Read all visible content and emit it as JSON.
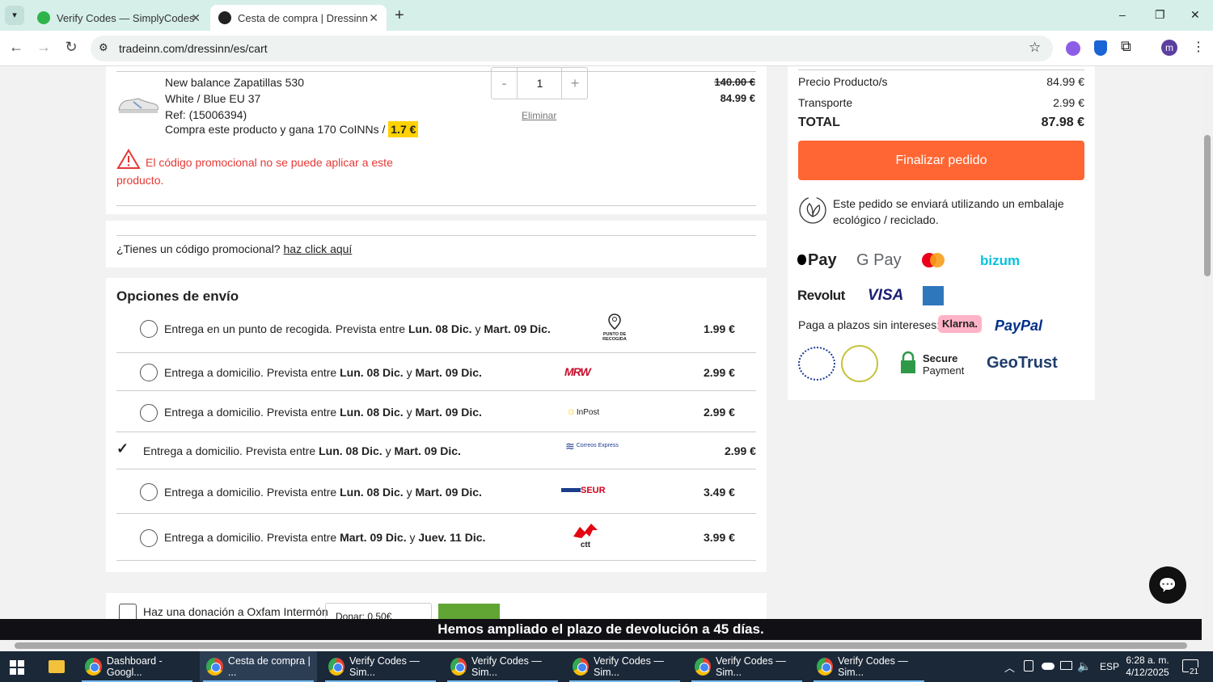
{
  "browser": {
    "tabs": [
      {
        "title": "Verify Codes — SimplyCodes",
        "active": false
      },
      {
        "title": "Cesta de compra | Dressinn",
        "active": true
      }
    ],
    "new_tab": "+",
    "url": "tradeinn.com/dressinn/es/cart",
    "window_controls": {
      "minimize": "–",
      "maximize": "❐",
      "close": "✕"
    },
    "profile_initial": "m"
  },
  "product": {
    "name": "New balance Zapatillas 530",
    "variant": "White / Blue EU 37",
    "ref": "Ref: (15006394)",
    "coins_text": "Compra este producto y gana 170 CoINNs / ",
    "coins_value": "1.7 €",
    "quantity": "1",
    "minus": "-",
    "plus": "+",
    "remove": "Eliminar",
    "old_price": "140.00 €",
    "price": "84.99 €",
    "promo_error": "El código promocional no se puede aplicar a este producto."
  },
  "promo": {
    "question": "¿Tienes un código promocional? ",
    "link": "haz click aquí"
  },
  "shipping": {
    "title": "Opciones de envío",
    "options": [
      {
        "pre": "Entrega en un punto de recogida. Prevista entre ",
        "d1": "Lun. 08 Dic.",
        "mid": " y ",
        "d2": "Mart. 09 Dic.",
        "carrier": "PUNTO DE RECOGIDA",
        "price": "1.99 €",
        "selected": false
      },
      {
        "pre": "Entrega a domicilio. Prevista entre ",
        "d1": "Lun. 08 Dic.",
        "mid": " y ",
        "d2": "Mart. 09 Dic.",
        "carrier": "MRW",
        "price": "2.99 €",
        "selected": false
      },
      {
        "pre": "Entrega a domicilio. Prevista entre ",
        "d1": "Lun. 08 Dic.",
        "mid": " y ",
        "d2": "Mart. 09 Dic.",
        "carrier": "InPost",
        "price": "2.99 €",
        "selected": false
      },
      {
        "pre": "Entrega a domicilio. Prevista entre ",
        "d1": "Lun. 08 Dic.",
        "mid": " y ",
        "d2": "Mart. 09 Dic.",
        "carrier": "Correos Express",
        "price": "2.99 €",
        "selected": true
      },
      {
        "pre": "Entrega a domicilio. Prevista entre ",
        "d1": "Lun. 08 Dic.",
        "mid": " y ",
        "d2": "Mart. 09 Dic.",
        "carrier": "SEUR",
        "price": "3.49 €",
        "selected": false
      },
      {
        "pre": "Entrega a domicilio. Prevista entre ",
        "d1": "Mart. 09 Dic.",
        "mid": " y ",
        "d2": "Juev. 11 Dic.",
        "carrier": "ctt",
        "price": "3.99 €",
        "selected": false
      }
    ]
  },
  "donation": {
    "label": "Haz una donación a Oxfam Intermón",
    "select_value": "Donar: 0.50€"
  },
  "summary": {
    "product_label": "Precio Producto/s",
    "product_value": "84.99 €",
    "shipping_label": "Transporte",
    "shipping_value": "2.99 €",
    "total_label": "TOTAL",
    "total_value": "87.98 €",
    "checkout_button": "Finalizar pedido",
    "eco_text": "Este pedido se enviará utilizando un embalaje ecológico / reciclado.",
    "payments": {
      "apple": "Pay",
      "google": "G Pay",
      "bizum": "bizum",
      "revolut": "Revolut",
      "visa": "VISA",
      "klarna_label": "Paga a plazos sin intereses:",
      "klarna": "Klarna.",
      "paypal": "PayPal"
    },
    "trust": {
      "secure_1": "Secure",
      "secure_2": "Payment",
      "geotrust": "GeoTrust"
    }
  },
  "banner": "Hemos ampliado el plazo de devolución a 45 días.",
  "taskbar": {
    "items": [
      "Dashboard - Googl...",
      "Cesta de compra | ...",
      "Verify Codes — Sim...",
      "Verify Codes — Sim...",
      "Verify Codes — Sim...",
      "Verify Codes — Sim...",
      "Verify Codes — Sim..."
    ],
    "language": "ESP",
    "time": "6:28 a. m.",
    "date": "4/12/2025",
    "notifications": "21"
  },
  "colors": {
    "accent": "#ff6633",
    "error": "#e53935",
    "banner": "#101015",
    "tabbar": "#d6efe9"
  }
}
